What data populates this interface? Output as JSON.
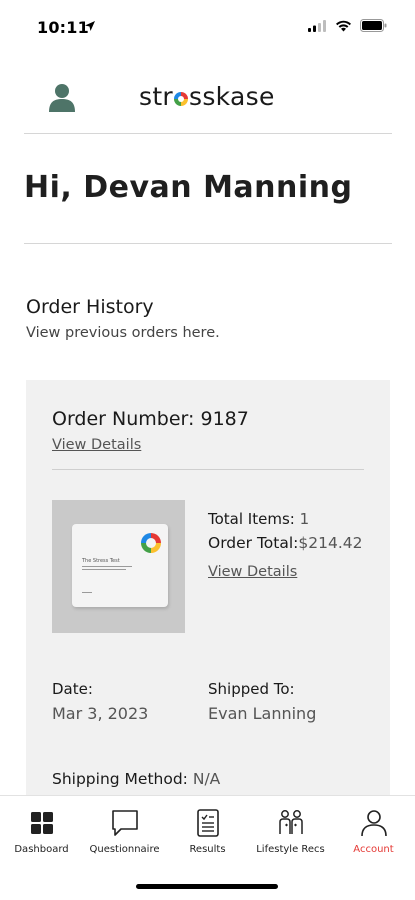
{
  "status_bar": {
    "time": "10:11"
  },
  "header": {
    "brand_before": "str",
    "brand_after": "sskase"
  },
  "greeting": "Hi, Devan Manning",
  "order_history": {
    "title": "Order History",
    "subtitle": "View previous orders here."
  },
  "order": {
    "number_label": "Order Number:",
    "number": "9187",
    "view_details": "View Details",
    "product_box": {
      "title": "The Stress Test"
    },
    "total_items_label": "Total Items:",
    "total_items": "1",
    "order_total_label": "Order Total:",
    "order_total": "$214.42",
    "view_details_2": "View Details",
    "date_label": "Date:",
    "date": "Mar 3, 2023",
    "shipped_to_label": "Shipped To:",
    "shipped_to": "Evan Lanning",
    "shipping_method_label": "Shipping Method:",
    "shipping_method": "N/A"
  },
  "tabs": [
    {
      "label": "Dashboard",
      "icon": "grid-icon"
    },
    {
      "label": "Questionnaire",
      "icon": "chat-icon"
    },
    {
      "label": "Results",
      "icon": "document-icon"
    },
    {
      "label": "Lifestyle Recs",
      "icon": "people-icon"
    },
    {
      "label": "Account",
      "icon": "person-icon",
      "active": true
    }
  ],
  "colors": {
    "accent": "#e53935",
    "card_bg": "#f1f1f1"
  }
}
